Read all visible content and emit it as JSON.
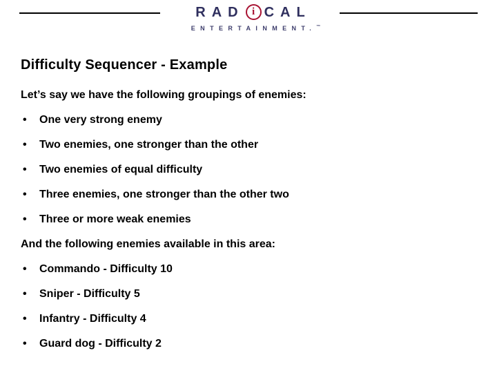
{
  "header": {
    "logo": {
      "word_part1": "RAD",
      "circled_letter": "i",
      "word_part2": "CAL",
      "subtitle": "ENTERTAINMENT.",
      "trademark": "™",
      "word_color": "#2f2f5e",
      "circle_color": "#a81333",
      "rule_color": "#000000"
    }
  },
  "slide": {
    "title": "Difficulty Sequencer - Example",
    "intro_1": "Let’s say we have the following groupings of enemies:",
    "groupings": [
      {
        "bullet": "•",
        "text": "One very strong enemy"
      },
      {
        "bullet": "•",
        "text": "Two enemies, one stronger than the other"
      },
      {
        "bullet": "•",
        "text": "Two enemies of equal difficulty"
      },
      {
        "bullet": "•",
        "text": "Three enemies, one stronger than the other two"
      },
      {
        "bullet": "•",
        "text": "Three or more weak enemies"
      }
    ],
    "intro_2": "And the following enemies available in this area:",
    "enemies": [
      {
        "bullet": "•",
        "text": "Commando - Difficulty 10"
      },
      {
        "bullet": "•",
        "text": "Sniper - Difficulty 5"
      },
      {
        "bullet": "•",
        "text": "Infantry - Difficulty 4"
      },
      {
        "bullet": "•",
        "text": "Guard dog - Difficulty 2"
      }
    ]
  }
}
